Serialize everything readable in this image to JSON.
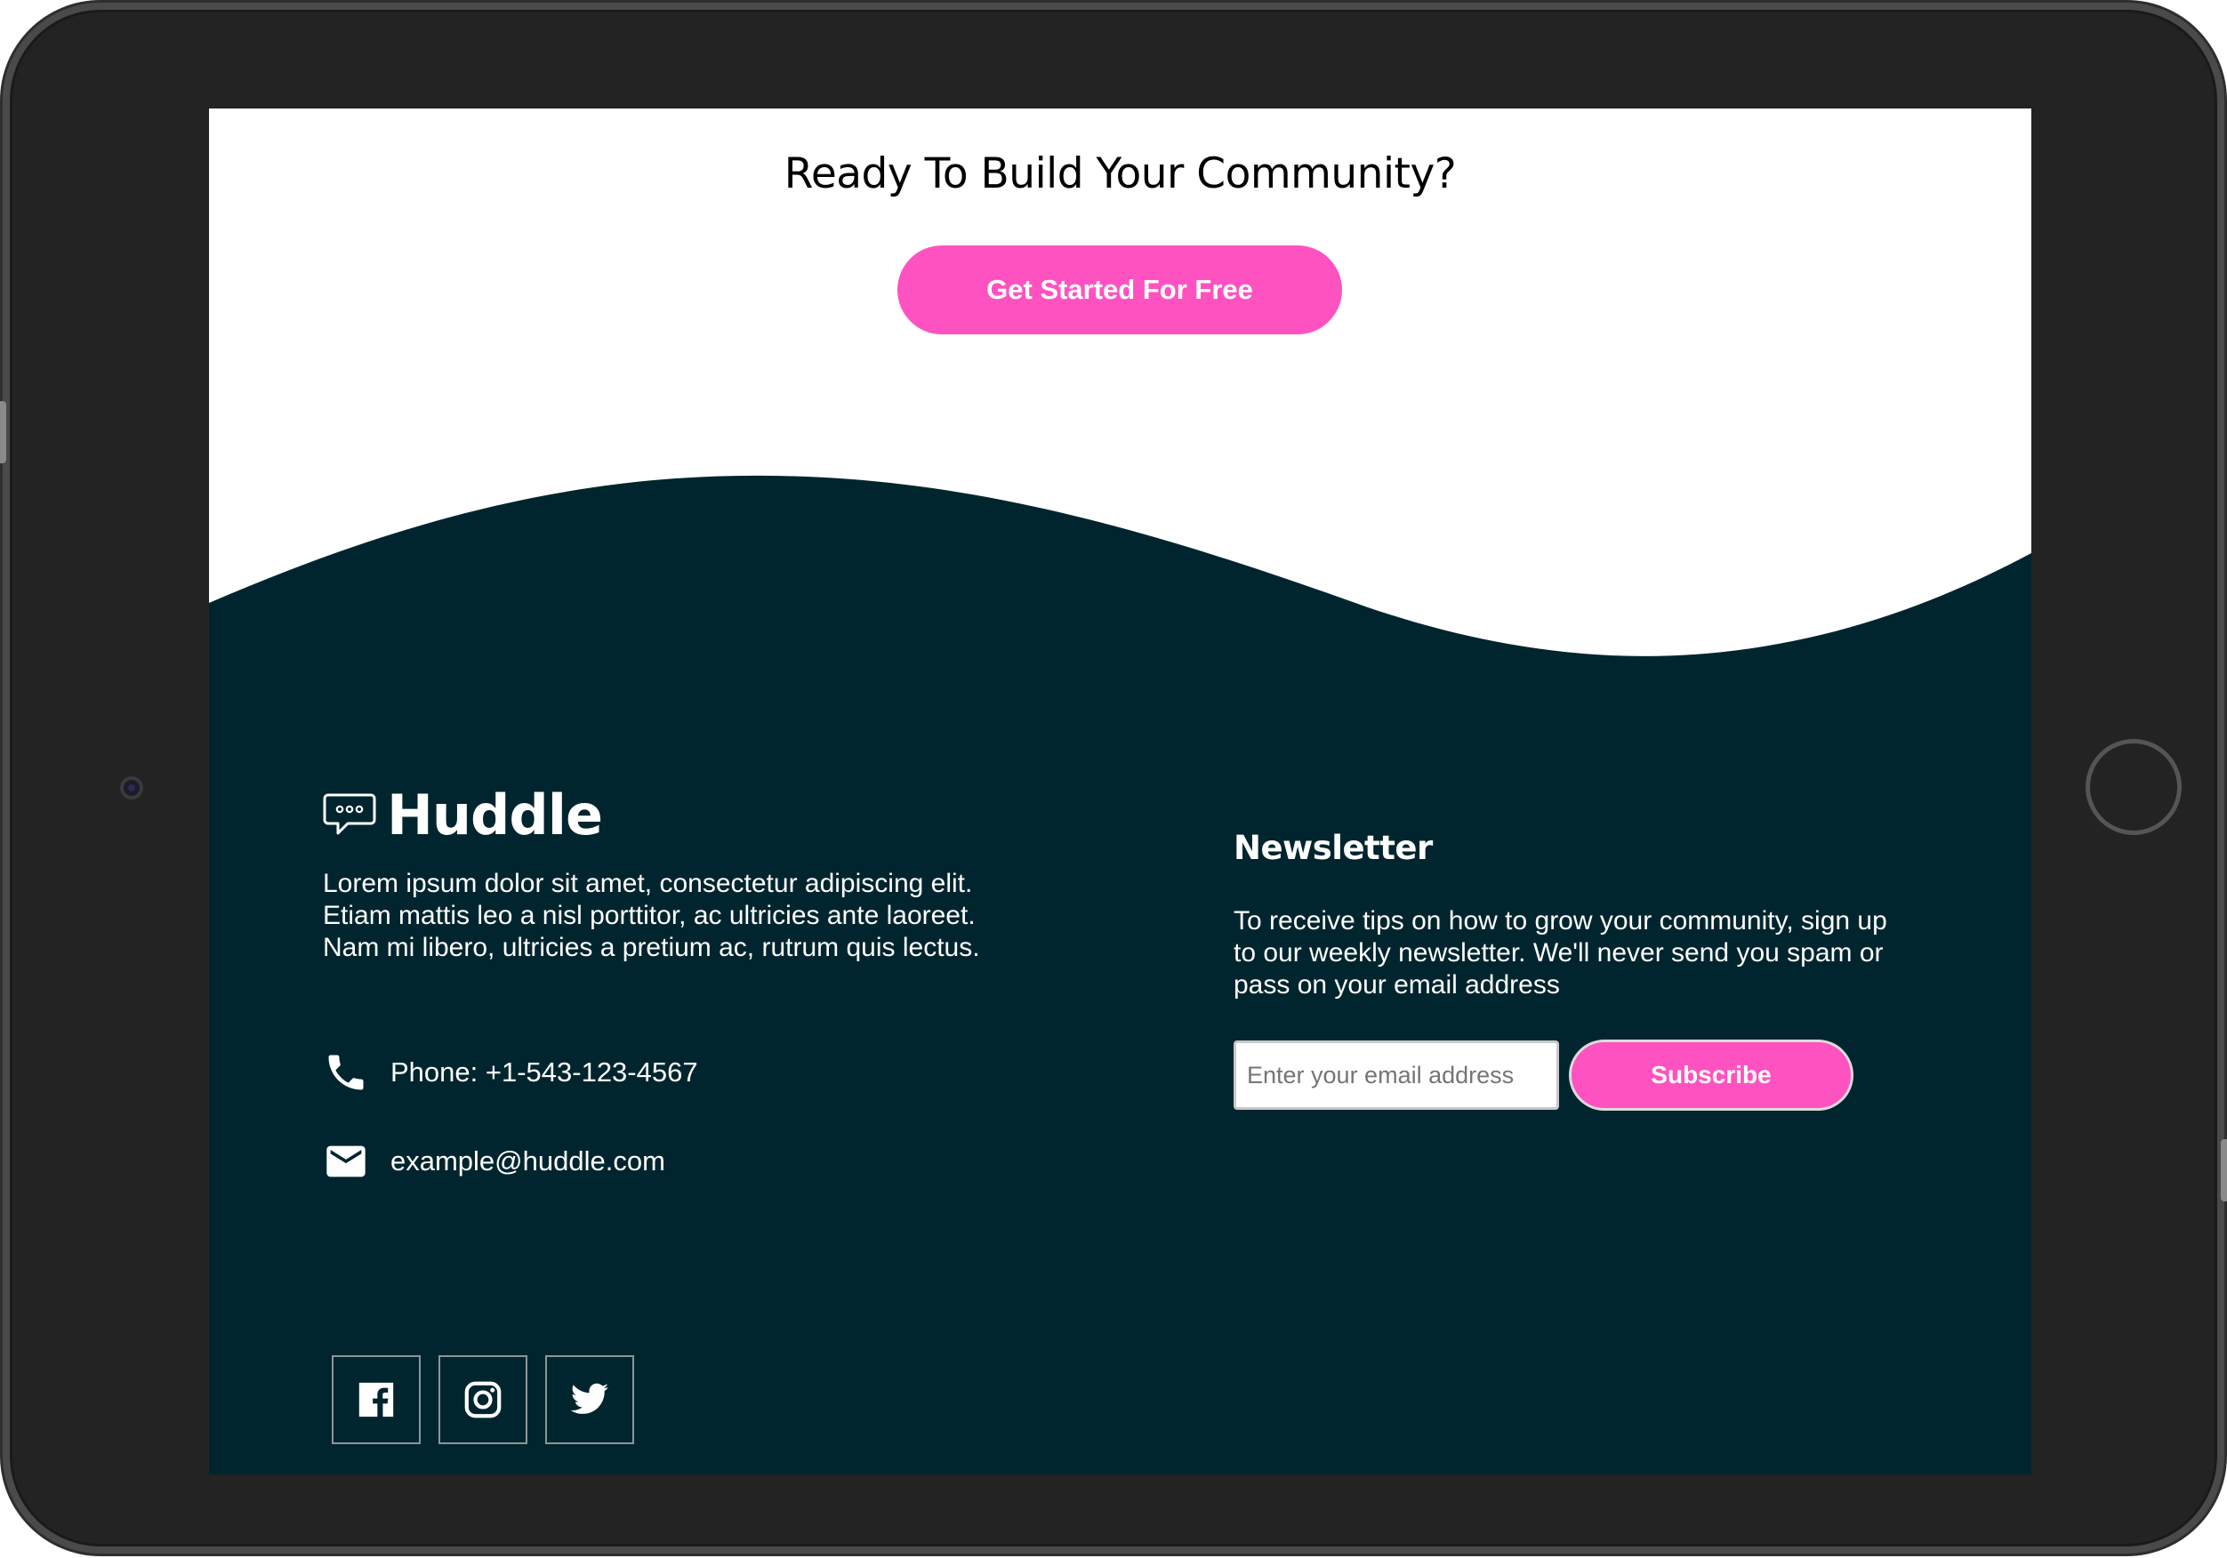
{
  "cta": {
    "title": "Ready To Build Your Community?",
    "button_label": "Get Started For Free"
  },
  "footer": {
    "brand": "Huddle",
    "about": "Lorem ipsum dolor sit amet, consectetur adipiscing elit. Etiam mattis leo a nisl porttitor, ac ultricies ante laoreet. Nam mi libero, ultricies a pretium ac, rutrum quis lectus.",
    "phone": "Phone: +1-543-123-4567",
    "email": "example@huddle.com",
    "social": [
      {
        "icon": "facebook-icon"
      },
      {
        "icon": "instagram-icon"
      },
      {
        "icon": "twitter-icon"
      }
    ]
  },
  "newsletter": {
    "title": "Newsletter",
    "text": "To receive tips on how to grow your community, sign up to our weekly newsletter. We'll never send you spam or pass on your email address",
    "email_placeholder": "Enter your email address",
    "email_value": "",
    "subscribe_label": "Subscribe"
  },
  "colors": {
    "accent": "#ff52c1",
    "footer_bg": "#00252e",
    "device_frame": "#232323"
  }
}
